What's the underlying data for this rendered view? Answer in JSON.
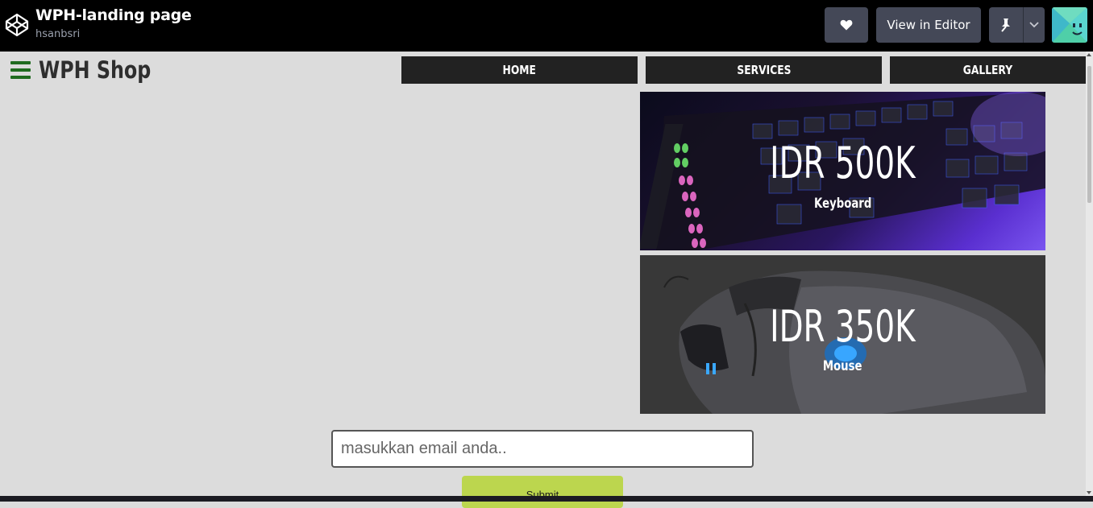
{
  "codepen": {
    "title": "WPH-landing page",
    "author": "hsanbsri",
    "view_in_editor_label": "View in Editor",
    "icons": [
      "codepen-logo-icon",
      "heart-icon",
      "pin-icon",
      "chevron-down-icon"
    ]
  },
  "site": {
    "brand": "WPH Shop",
    "nav": [
      {
        "label": "HOME"
      },
      {
        "label": "SERVICES"
      },
      {
        "label": "GALLERY"
      }
    ],
    "products": [
      {
        "price": "IDR 500K",
        "name": "Keyboard"
      },
      {
        "price": "IDR 350K",
        "name": "Mouse"
      }
    ],
    "email_placeholder": "masukkan email anda..",
    "submit_label": "Submit"
  },
  "colors": {
    "topbar_bg": "#000000",
    "button_bg": "#444857",
    "page_bg": "#dcdcdc",
    "nav_bg": "#222222",
    "hamburger": "#1f6b1f",
    "submit_bg": "#bcd64e"
  }
}
